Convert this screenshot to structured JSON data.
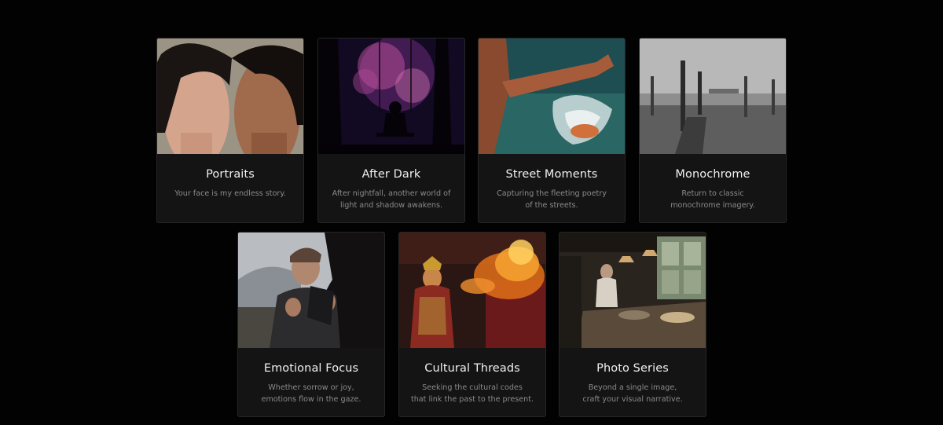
{
  "cards": [
    {
      "title": "Portraits",
      "desc": [
        "Your face is my endless story."
      ]
    },
    {
      "title": "After Dark",
      "desc": [
        "After nightfall, another world of",
        "light and shadow awakens."
      ]
    },
    {
      "title": "Street Moments",
      "desc": [
        "Capturing the fleeting poetry",
        "of the streets."
      ]
    },
    {
      "title": "Monochrome",
      "desc": [
        "Return to classic",
        "monochrome imagery."
      ]
    },
    {
      "title": "Emotional Focus",
      "desc": [
        "Whether sorrow or joy,",
        "emotions flow in the gaze."
      ]
    },
    {
      "title": "Cultural Threads",
      "desc": [
        "Seeking the cultural codes",
        "that link the past to the present."
      ]
    },
    {
      "title": "Photo Series",
      "desc": [
        "Beyond a single image,",
        "craft your visual narrative."
      ]
    }
  ]
}
